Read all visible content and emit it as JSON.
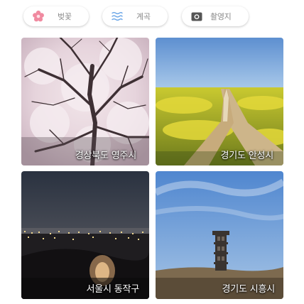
{
  "filters": [
    {
      "label": "벚꽃",
      "icon": "cherry-blossom-icon",
      "icon_color": "#e8708a"
    },
    {
      "label": "계곡",
      "icon": "water-waves-icon",
      "icon_color": "#6ea8e8"
    },
    {
      "label": "촬영지",
      "icon": "camera-icon",
      "icon_color": "#555555"
    }
  ],
  "photos": [
    {
      "caption": "경상북도 영주시",
      "subject": "cherry blossom tree"
    },
    {
      "caption": "경기도 안성시",
      "subject": "yellow canola field with dirt path"
    },
    {
      "caption": "서울시 동작구",
      "subject": "city night view"
    },
    {
      "caption": "경기도 시흥시",
      "subject": "observation tower on hill"
    }
  ]
}
